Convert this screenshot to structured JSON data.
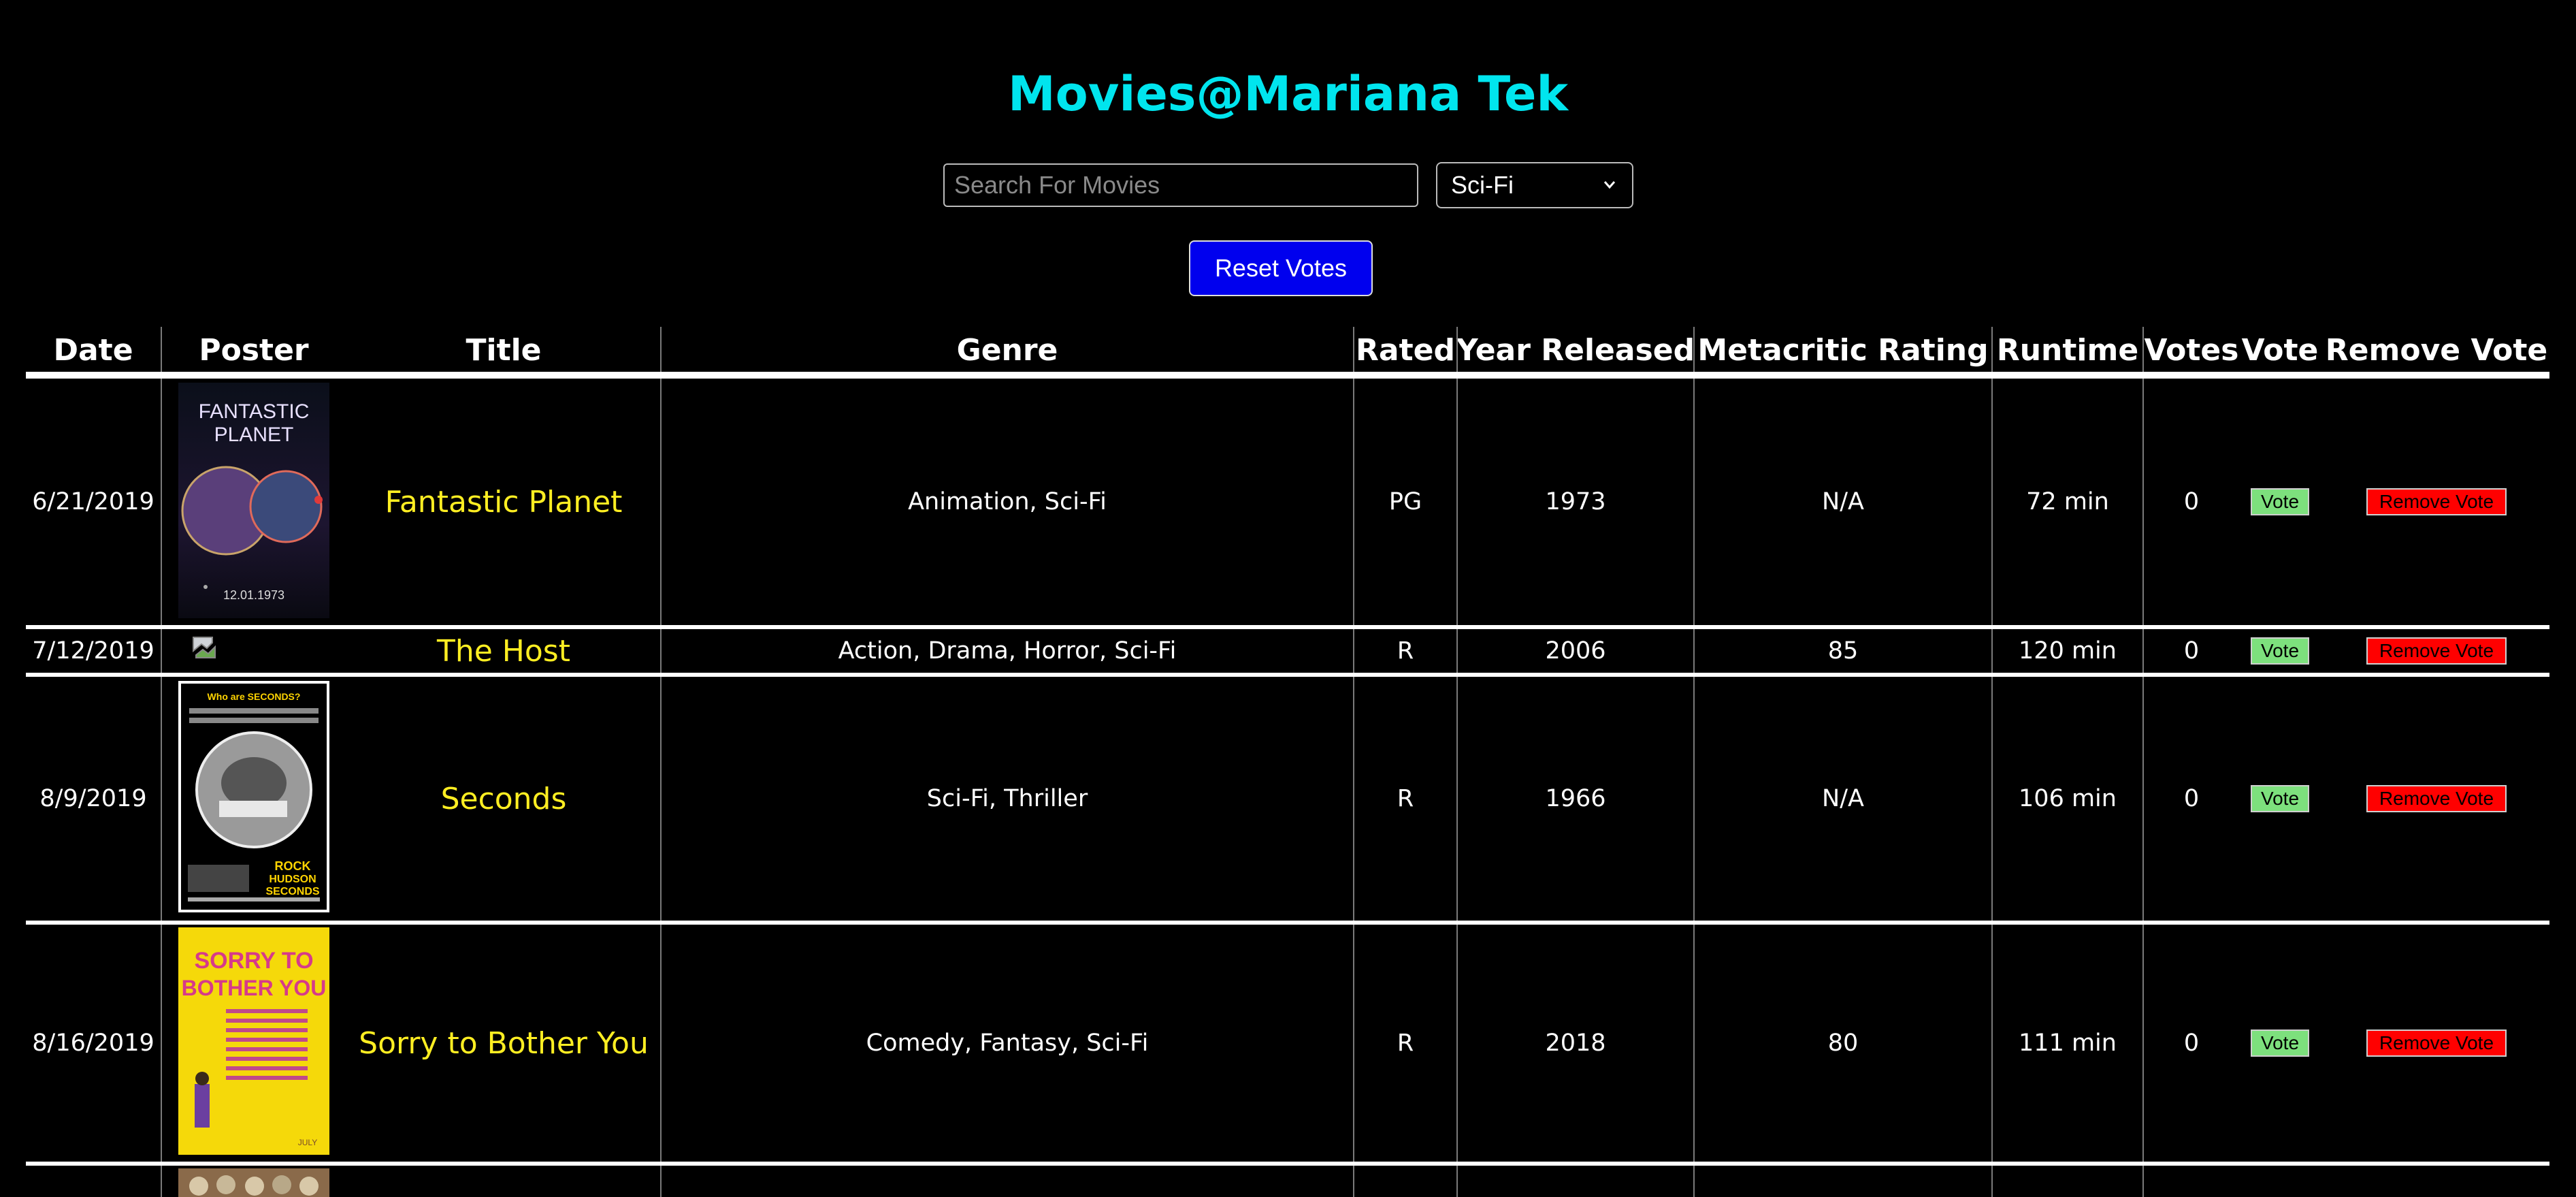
{
  "app": {
    "title": "Movies@Mariana Tek"
  },
  "controls": {
    "search_placeholder": "Search For Movies",
    "search_value": "",
    "genre_selected": "Sci-Fi",
    "reset_label": "Reset Votes"
  },
  "table": {
    "headers": {
      "date": "Date",
      "poster": "Poster",
      "title": "Title",
      "genre": "Genre",
      "rated": "Rated",
      "year": "Year Released",
      "metacritic": "Metacritic Rating",
      "runtime": "Runtime",
      "votes": "Votes",
      "vote": "Vote",
      "remove": "Remove Vote"
    },
    "rows": [
      {
        "date": "6/21/2019",
        "title": "Fantastic Planet",
        "genre": "Animation, Sci-Fi",
        "rated": "PG",
        "year": "1973",
        "metacritic": "N/A",
        "runtime": "72 min",
        "votes": "0",
        "vote_label": "Vote",
        "remove_label": "Remove Vote",
        "poster": {
          "line1": "FANTASTIC",
          "line2": "PLANET",
          "date": "12.01.1973"
        }
      },
      {
        "date": "7/12/2019",
        "title": "The Host",
        "genre": "Action, Drama, Horror, Sci-Fi",
        "rated": "R",
        "year": "2006",
        "metacritic": "85",
        "runtime": "120 min",
        "votes": "0",
        "vote_label": "Vote",
        "remove_label": "Remove Vote"
      },
      {
        "date": "8/9/2019",
        "title": "Seconds",
        "genre": "Sci-Fi, Thriller",
        "rated": "R",
        "year": "1966",
        "metacritic": "N/A",
        "runtime": "106 min",
        "votes": "0",
        "vote_label": "Vote",
        "remove_label": "Remove Vote",
        "poster": {
          "tagline": "Who are SECONDS?",
          "star1": "ROCK",
          "star2": "HUDSON",
          "name": "SECONDS"
        }
      },
      {
        "date": "8/16/2019",
        "title": "Sorry to Bother You",
        "genre": "Comedy, Fantasy, Sci-Fi",
        "rated": "R",
        "year": "2018",
        "metacritic": "80",
        "runtime": "111 min",
        "votes": "0",
        "vote_label": "Vote",
        "remove_label": "Remove Vote",
        "poster": {
          "line1": "SORRY TO",
          "line2": "BOTHER YOU",
          "month": "JULY"
        }
      }
    ]
  },
  "colors": {
    "title": "#00e5ee",
    "movie_title": "#ffee22",
    "reset_button": "#0000ee",
    "vote_button": "#7de07d",
    "remove_button": "#ff0000"
  }
}
